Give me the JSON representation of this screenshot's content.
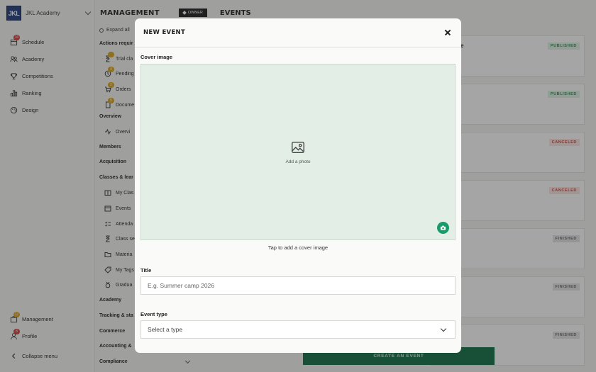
{
  "brand": {
    "logo_text": "JKL",
    "name": "JKL Academy"
  },
  "sidebar": {
    "items": [
      {
        "label": "Schedule",
        "icon": "calendar-icon",
        "badge": "10"
      },
      {
        "label": "Academy",
        "icon": "people-icon"
      },
      {
        "label": "Competitions",
        "icon": "trophy-icon"
      },
      {
        "label": "Ranking",
        "icon": "bar-chart-icon"
      },
      {
        "label": "Design",
        "icon": "palette-icon"
      }
    ],
    "bottom": [
      {
        "label": "Management",
        "icon": "briefcase-icon",
        "badge": "17"
      },
      {
        "label": "Profile",
        "icon": "user-icon",
        "badge": "8"
      },
      {
        "label": "Collapse menu",
        "icon": "chevron-left-icon"
      }
    ]
  },
  "submenu": {
    "expand_all": "Expand all",
    "sections": {
      "actions": "Actions requir",
      "overview": "Overview",
      "members": "Members",
      "acquisition": "Acquisition",
      "classes": "Classes & lear",
      "academy": "Academy",
      "tracking": "Tracking & sta",
      "commerce": "Commerce",
      "accounting": "Accounting &",
      "compliance": "Compliance"
    },
    "items": {
      "trial": "Trial cla",
      "pending": "Pending",
      "orders": "Orders",
      "documents": "Docume",
      "overview": "Overvi",
      "my_classes": "My Clas",
      "events": "Events",
      "attendance": "Attenda",
      "class_sessions": "Class se",
      "materials": "Materia",
      "my_tags": "My Tags",
      "graduations": "Gradua"
    },
    "badges": {
      "trial": "",
      "pending": "4",
      "orders": "2",
      "documents": "5"
    }
  },
  "header": {
    "management": "MANAGEMENT",
    "owner": "OWNER",
    "events": "EVENTS"
  },
  "cards": [
    {
      "status": "PUBLISHED",
      "kind": "pub",
      "title_fragment": "e"
    },
    {
      "status": "PUBLISHED",
      "kind": "pub"
    },
    {
      "status": "CANCELED",
      "kind": "can"
    },
    {
      "status": "CANCELED",
      "kind": "can"
    },
    {
      "status": "FINISHED",
      "kind": "fin"
    },
    {
      "status": "FINISHED",
      "kind": "fin"
    },
    {
      "status": "FINISHED",
      "kind": "fin"
    }
  ],
  "create_button": "CREATE AN EVENT",
  "modal": {
    "title": "NEW EVENT",
    "cover_label": "Cover image",
    "add_photo": "Add a photo",
    "tap_hint": "Tap to add a cover image",
    "title_label": "Title",
    "title_placeholder": "E.g. Summer camp 2026",
    "type_label": "Event type",
    "type_placeholder": "Select a type"
  },
  "colors": {
    "accent": "#0d6b42",
    "cover_bg": "#e3efe6",
    "camera": "#1a9a6a",
    "logo": "#1d3a78"
  }
}
